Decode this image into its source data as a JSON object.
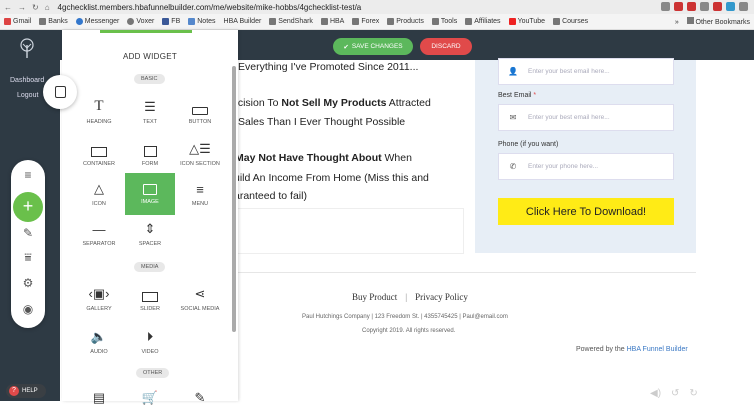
{
  "browser": {
    "url": "4gchecklist.members.hbafunnelbuilder.com/me/website/mike-hobbs/4gchecklist-test/a",
    "bookmarks": [
      "Gmail",
      "Banks",
      "Messenger",
      "Voxer",
      "FB",
      "Notes",
      "HBA Builder",
      "SendShark",
      "HBA",
      "Forex",
      "Products",
      "Tools",
      "Affiliates",
      "YouTube",
      "Courses"
    ],
    "more": "»",
    "other_bookmarks": "Other Bookmarks"
  },
  "builder": {
    "dashboard": "Dashboard",
    "logout": "Logout",
    "save_label": "SAVE CHANGES",
    "discard_label": "DISCARD",
    "help_label": "HELP",
    "accent": "#5cb85c"
  },
  "panel": {
    "title": "ADD WIDGET",
    "categories": {
      "basic": "BASIC",
      "media": "MEDIA",
      "other": "OTHER"
    },
    "widgets": {
      "heading": "HEADING",
      "text": "TEXT",
      "button": "BUTTON",
      "container": "CONTAINER",
      "form": "FORM",
      "icon_section": "ICON SECTION",
      "icon": "ICON",
      "image": "IMAGE",
      "menu": "MENU",
      "separator": "SEPARATOR",
      "spacer": "SPACER",
      "gallery": "GALLERY",
      "slider": "SLIDER",
      "social_media": "SOCIAL MEDIA",
      "audio": "AUDIO",
      "video": "VIDEO"
    }
  },
  "page": {
    "line1": "Everything I've Promoted Since 2011...",
    "line2_pre": "ecision To ",
    "line2_bold": "Not Sell My Products",
    "line2_post": " Attracted",
    "line3": "Sales Than I Ever Thought Possible",
    "line4_bold": "May Not Have Thought About",
    "line4_post": " When",
    "line5": "uild An Income From Home (Miss this and",
    "line6": "aranteed to fail)"
  },
  "form": {
    "name_placeholder": "Enter your best email here...",
    "email_label": "Best Email",
    "email_required": "*",
    "email_placeholder": "Enter your best email here...",
    "phone_label": "Phone (if you want)",
    "phone_placeholder": "Enter your phone here...",
    "download_label": "Click Here To Download!",
    "download_color": "#ffeb16"
  },
  "footer": {
    "buy_product": "Buy Product",
    "separator": "|",
    "privacy_policy": "Privacy Policy",
    "company": "Paul Hutchings Company | 123 Freedom St. | 4355745425 | Paul@email.com",
    "copyright": "Copyright 2019. All rights reserved.",
    "powered_pre": "Powered by the ",
    "powered_brand": "HBA Funnel Builder"
  }
}
